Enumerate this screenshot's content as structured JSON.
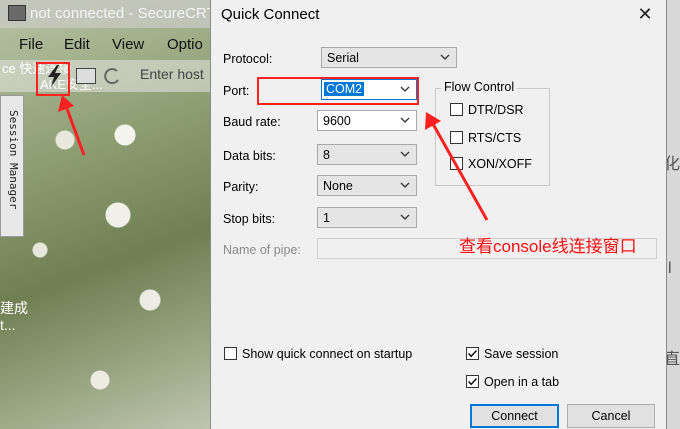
{
  "background_window": {
    "title": "not connected - SecureCRT",
    "menu": [
      "File",
      "Edit",
      "View",
      "Optio"
    ],
    "toolbar_text": "Enter host",
    "side_tab": "Session Manager",
    "overlay_text_1": "ce 快速连接",
    "overlay_text_2": "AKE安全...",
    "side_caption_1": "建成",
    "side_caption_2": "t..."
  },
  "dialog": {
    "title": "Quick Connect",
    "close_icon": "close-icon",
    "fields": {
      "protocol": {
        "label": "Protocol:",
        "value": "Serial"
      },
      "port": {
        "label": "Port:",
        "value": "COM2"
      },
      "baud_rate": {
        "label": "Baud rate:",
        "value": "9600"
      },
      "data_bits": {
        "label": "Data bits:",
        "value": "8"
      },
      "parity": {
        "label": "Parity:",
        "value": "None"
      },
      "stop_bits": {
        "label": "Stop bits:",
        "value": "1"
      },
      "name_of_pipe": {
        "label": "Name of pipe:",
        "value": ""
      }
    },
    "flow_control": {
      "legend": "Flow Control",
      "dtr_dsr": {
        "label": "DTR/DSR",
        "checked": false
      },
      "rts_cts": {
        "label": "RTS/CTS",
        "checked": false
      },
      "xon_xoff": {
        "label": "XON/XOFF",
        "checked": false
      }
    },
    "show_quick_connect": {
      "label": "Show quick connect on startup",
      "checked": false
    },
    "save_session": {
      "label": "Save session",
      "checked": true
    },
    "open_in_tab": {
      "label": "Open in a tab",
      "checked": true
    },
    "connect_label": "Connect",
    "cancel_label": "Cancel"
  },
  "annotation": {
    "text": "查看console线连接窗口",
    "color": "#ff1010"
  },
  "right_edge_chars": [
    "化",
    "l",
    "直"
  ]
}
